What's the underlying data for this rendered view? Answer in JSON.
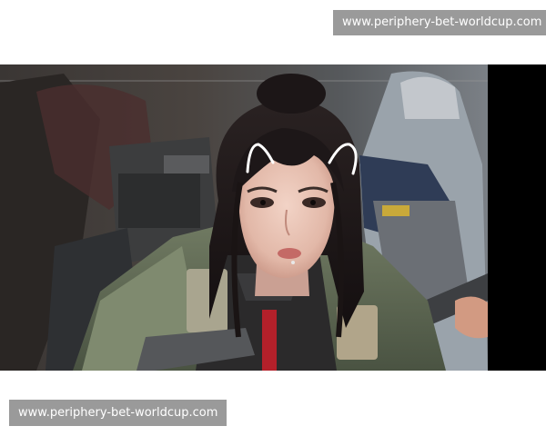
{
  "watermark_top": {
    "text": "www.periphery-bet-worldcup.com"
  },
  "watermark_bottom": {
    "text": "www.periphery-bet-worldcup.com"
  },
  "scene": {
    "subject": "character-in-tactical-gear",
    "accent_color": "#b3202a",
    "overlay_icon": "cat-ears-icon"
  }
}
